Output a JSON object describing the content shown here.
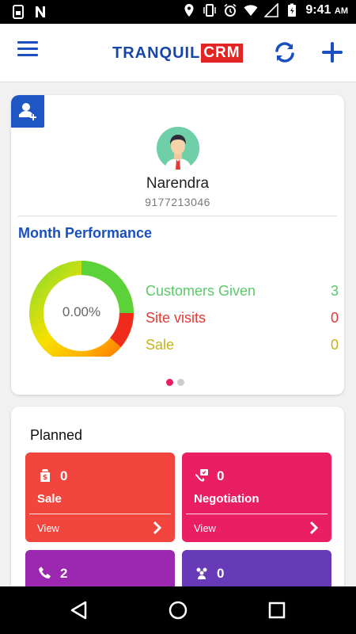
{
  "status_bar": {
    "time": "9:41",
    "ampm": "AM",
    "icons": [
      "sim-card-icon",
      "n-logo-icon",
      "location-icon",
      "vibrate-icon",
      "alarm-icon",
      "wifi-icon",
      "signal-icon",
      "battery-charging-icon"
    ]
  },
  "app_bar": {
    "logo_part1": "TRANQUIL",
    "logo_part2": "CRM",
    "icons": [
      "menu-icon",
      "refresh-icon",
      "plus-icon"
    ],
    "colors": {
      "primary": "#1a4fbf",
      "logo_red": "#e22523"
    }
  },
  "profile": {
    "name": "Narendra",
    "phone": "9177213046",
    "icons": [
      "add-user-icon",
      "avatar-icon"
    ]
  },
  "performance": {
    "title": "Month Performance",
    "percent_text": "0.00%",
    "metrics": [
      {
        "label": "Customers Given",
        "value": "3",
        "color": "#5bc96a"
      },
      {
        "label": "Site visits",
        "value": "0",
        "color": "#e53935"
      },
      {
        "label": "Sale",
        "value": "0",
        "color": "#c8b21a"
      }
    ],
    "page_indicator": {
      "pages": 2,
      "active": 1
    }
  },
  "planned": {
    "title": "Planned",
    "tiles": [
      {
        "icon": "sale-bag-icon",
        "count": "0",
        "label": "Sale",
        "view": "View",
        "color": "#f2453d"
      },
      {
        "icon": "negotiation-icon",
        "count": "0",
        "label": "Negotiation",
        "view": "View",
        "color": "#e91e63"
      },
      {
        "icon": "phone-icon",
        "count": "2",
        "color": "#9c27b0"
      },
      {
        "icon": "meeting-icon",
        "count": "0",
        "color": "#673ab7"
      }
    ]
  },
  "nav_bar": {
    "icons": [
      "back-icon",
      "home-icon",
      "recents-icon"
    ]
  }
}
